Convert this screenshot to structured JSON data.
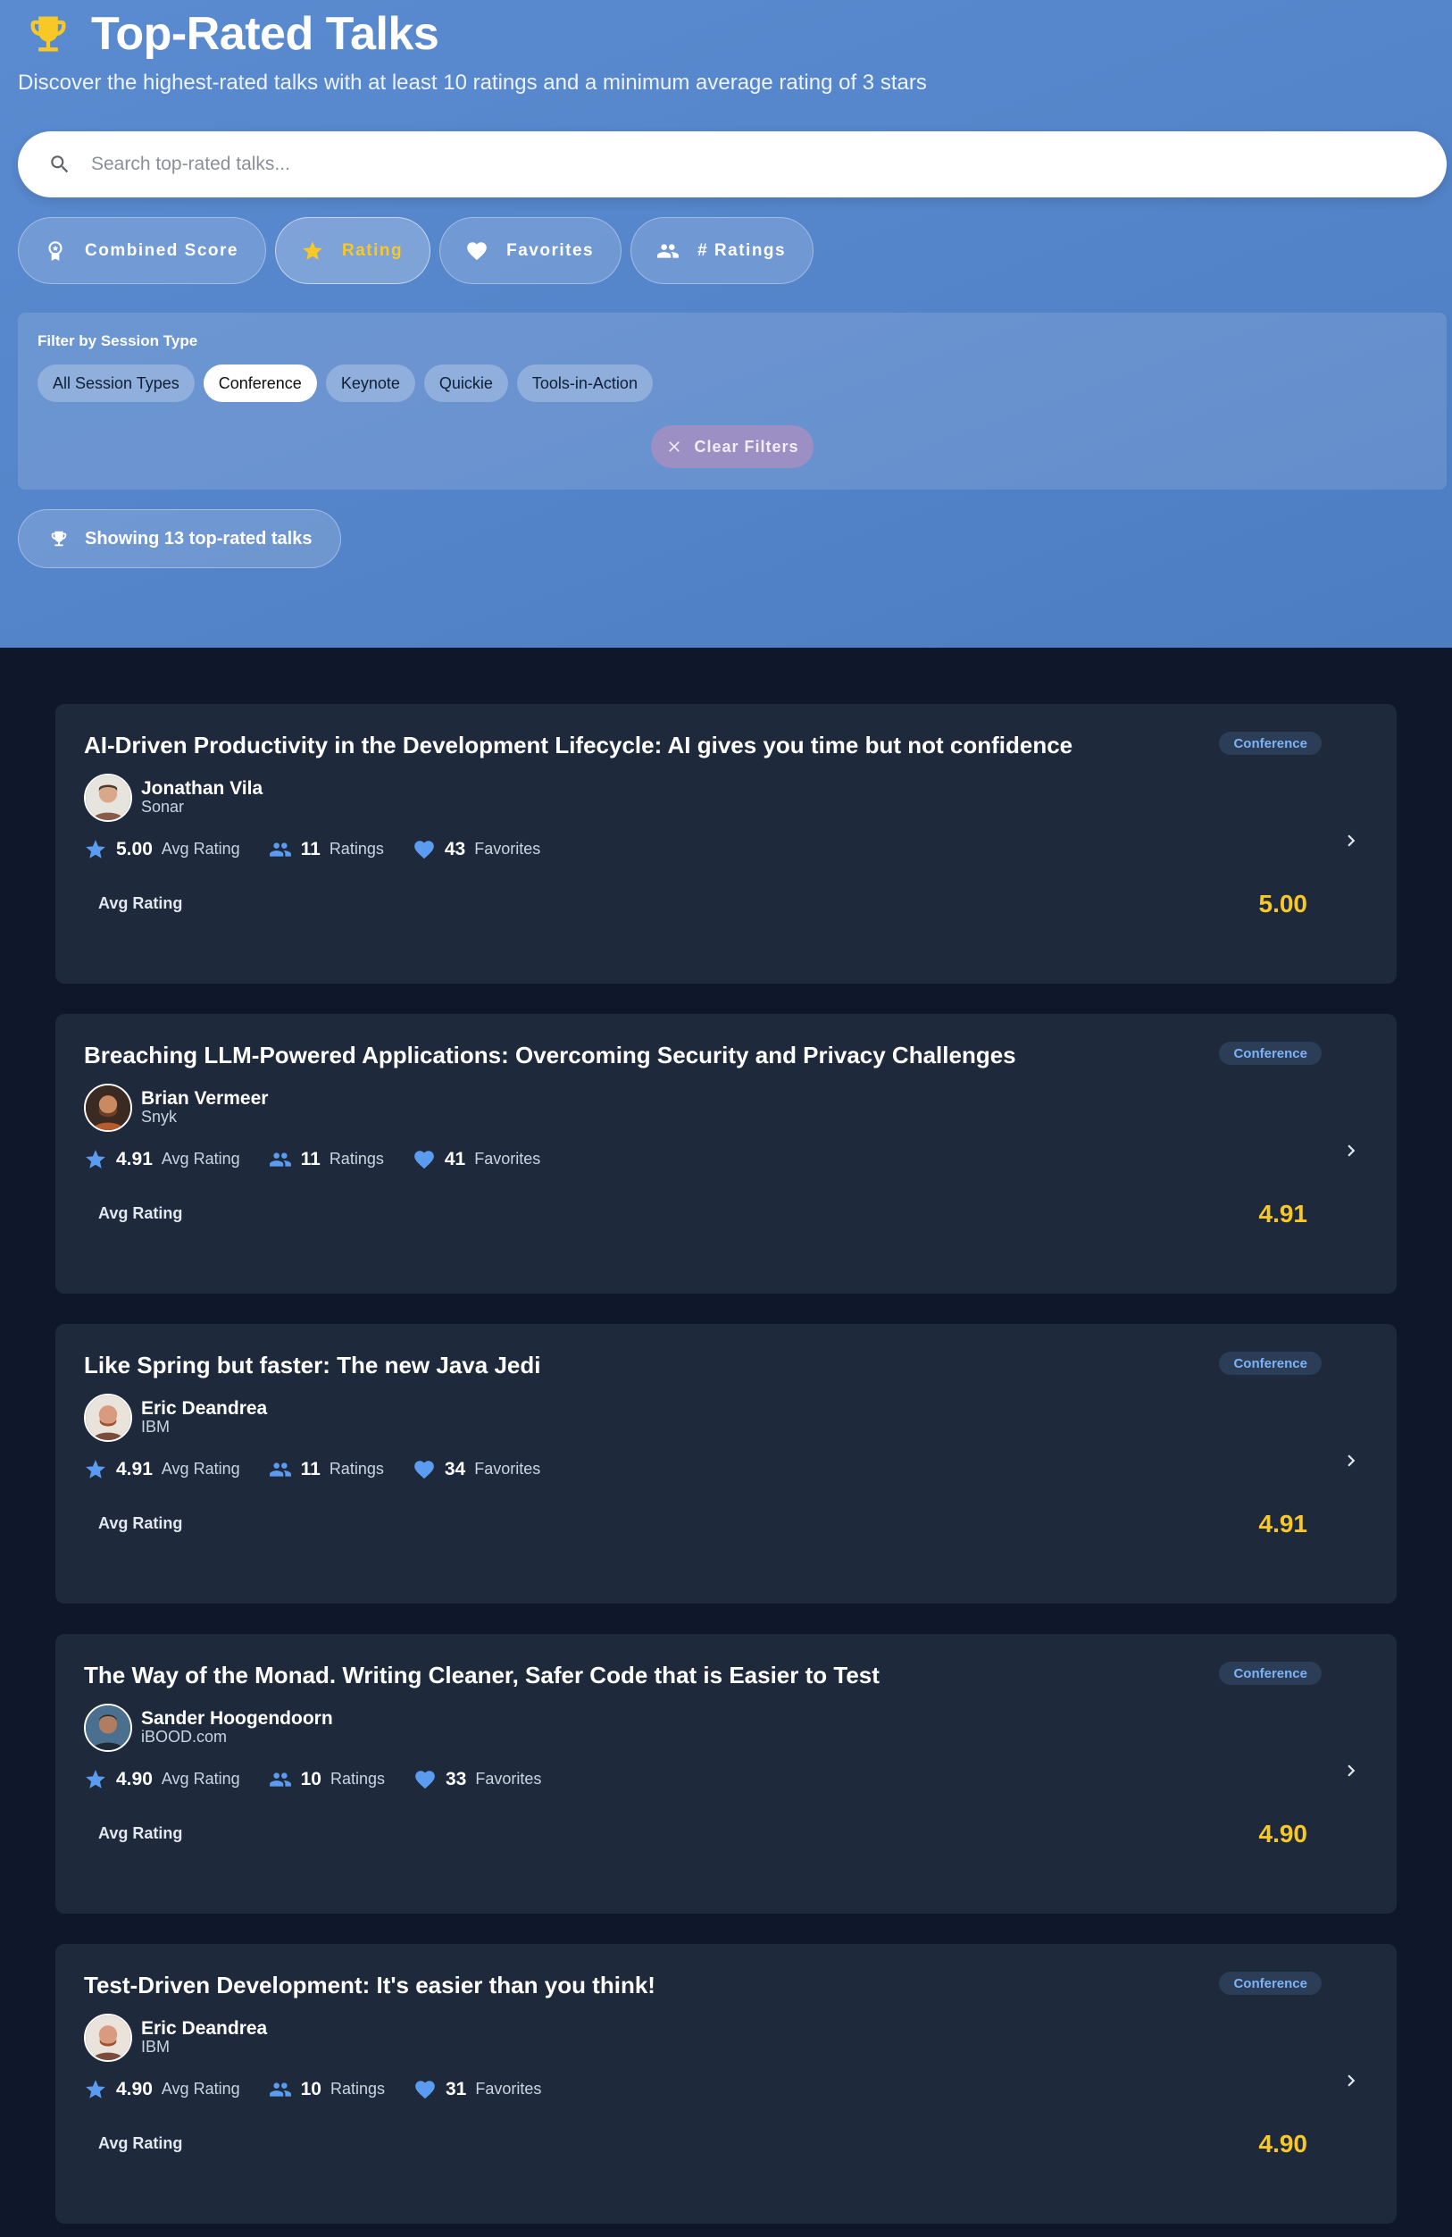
{
  "header": {
    "title": "Top-Rated Talks",
    "subtitle": "Discover the highest-rated talks with at least 10 ratings and a minimum average rating of 3 stars",
    "icon": "trophy-icon"
  },
  "search": {
    "placeholder": "Search top-rated talks..."
  },
  "sort_options": [
    {
      "label": "Combined Score",
      "icon": "award-icon",
      "active": false
    },
    {
      "label": "Rating",
      "icon": "star-icon",
      "active": true
    },
    {
      "label": "Favorites",
      "icon": "heart-icon",
      "active": false
    },
    {
      "label": "# Ratings",
      "icon": "people-icon",
      "active": false
    }
  ],
  "filter": {
    "label": "Filter by Session Type",
    "chips": [
      {
        "label": "All Session Types",
        "active": false
      },
      {
        "label": "Conference",
        "active": true
      },
      {
        "label": "Keynote",
        "active": false
      },
      {
        "label": "Quickie",
        "active": false
      },
      {
        "label": "Tools-in-Action",
        "active": false
      }
    ],
    "clear_label": "Clear Filters"
  },
  "result_count": "Showing 13 top-rated talks",
  "colors": {
    "accent": "#f8c827",
    "link": "#5b9cf0",
    "card_bg": "#1e293b",
    "page_bg": "#0f172a"
  },
  "talks": [
    {
      "title": "AI-Driven Productivity in the Development Lifecycle: AI gives you time but not confidence",
      "type": "Conference",
      "speaker": "Jonathan Vila",
      "company": "Sonar",
      "avg": "5.00",
      "avg_label": "Avg Rating",
      "ratings": "11",
      "ratings_label": "Ratings",
      "favorites": "43",
      "favorites_label": "Favorites",
      "score_label": "Avg Rating",
      "score": "5.00"
    },
    {
      "title": "Breaching LLM-Powered Applications: Overcoming Security and Privacy Challenges",
      "type": "Conference",
      "speaker": "Brian Vermeer",
      "company": "Snyk",
      "avg": "4.91",
      "avg_label": "Avg Rating",
      "ratings": "11",
      "ratings_label": "Ratings",
      "favorites": "41",
      "favorites_label": "Favorites",
      "score_label": "Avg Rating",
      "score": "4.91"
    },
    {
      "title": "Like Spring but faster: The new Java Jedi",
      "type": "Conference",
      "speaker": "Eric Deandrea",
      "company": "IBM",
      "avg": "4.91",
      "avg_label": "Avg Rating",
      "ratings": "11",
      "ratings_label": "Ratings",
      "favorites": "34",
      "favorites_label": "Favorites",
      "score_label": "Avg Rating",
      "score": "4.91"
    },
    {
      "title": "The Way of the Monad. Writing Cleaner, Safer Code that is Easier to Test",
      "type": "Conference",
      "speaker": "Sander Hoogendoorn",
      "company": "iBOOD.com",
      "avg": "4.90",
      "avg_label": "Avg Rating",
      "ratings": "10",
      "ratings_label": "Ratings",
      "favorites": "33",
      "favorites_label": "Favorites",
      "score_label": "Avg Rating",
      "score": "4.90"
    },
    {
      "title": "Test-Driven Development: It's easier than you think!",
      "type": "Conference",
      "speaker": "Eric Deandrea",
      "company": "IBM",
      "avg": "4.90",
      "avg_label": "Avg Rating",
      "ratings": "10",
      "ratings_label": "Ratings",
      "favorites": "31",
      "favorites_label": "Favorites",
      "score_label": "Avg Rating",
      "score": "4.90"
    }
  ]
}
